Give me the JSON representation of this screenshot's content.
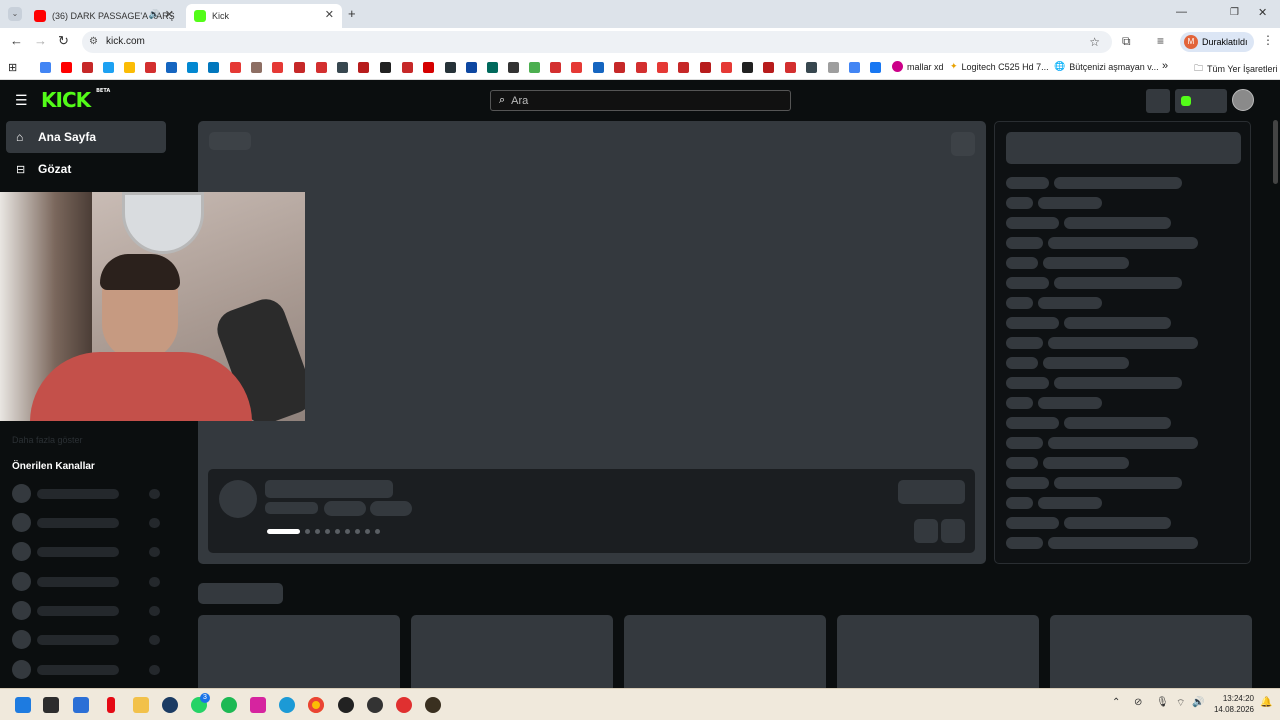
{
  "browser": {
    "tabs": [
      {
        "label": "(36) DARK PASSAGE'A KARŞ",
        "active": false
      },
      {
        "label": "Kick",
        "active": true
      }
    ],
    "url": "kick.com",
    "profile_label": "Duraklatıldı",
    "profile_initial": "M",
    "bookmarks": {
      "b1": "mallar xd",
      "b2": "Logitech C525 Hd 7...",
      "b3": "Bütçenizi aşmayan v...",
      "all": "Tüm Yer İşaretleri"
    }
  },
  "kick": {
    "logo": "KICK",
    "beta": "BETA",
    "search_placeholder": "Ara",
    "nav": {
      "home": "Ana Sayfa",
      "browse": "Gözat"
    },
    "recommended_header": "Önerilen Kanallar",
    "faded_label": "Daha fazla göster"
  },
  "taskbar": {
    "time": "13:24:20",
    "date": "14.08.2026",
    "whatsapp_badge": "3"
  },
  "colors": {
    "kick_green": "#53fc18",
    "placeholder": "#34393e",
    "background": "#0b0e0f"
  }
}
